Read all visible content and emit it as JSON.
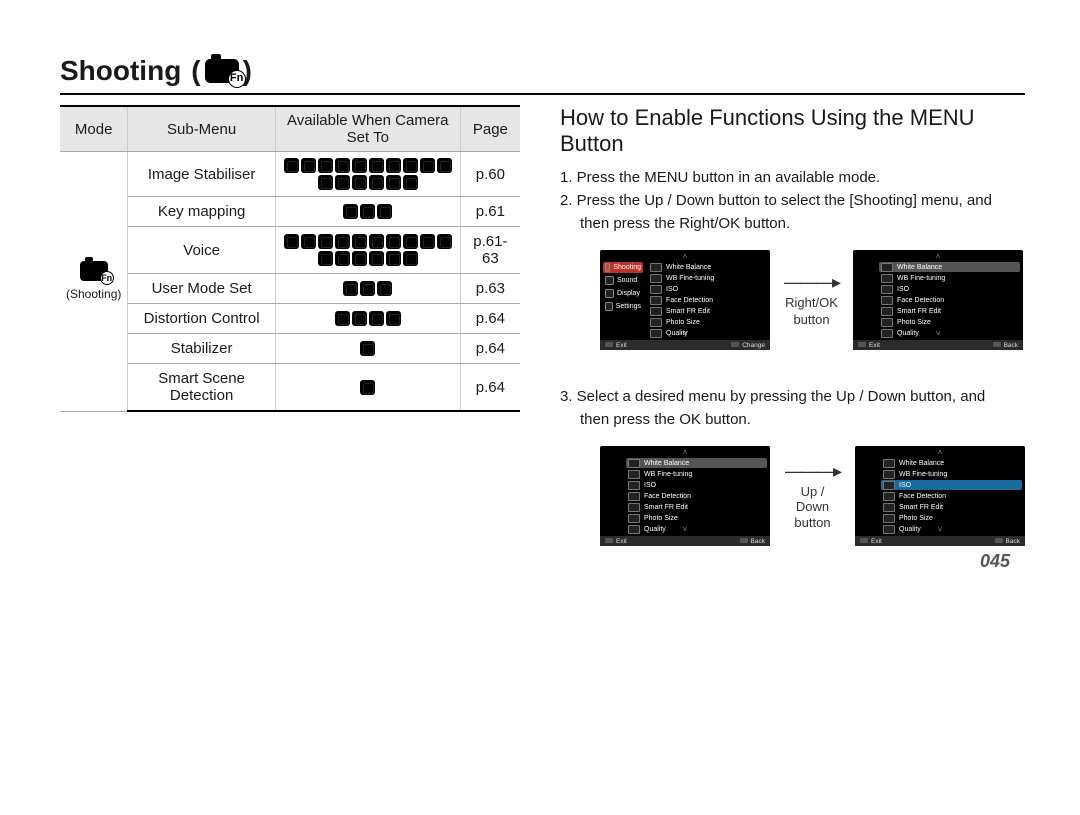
{
  "title": "Shooting",
  "page_number": "045",
  "table": {
    "headers": [
      "Mode",
      "Sub-Menu",
      "Available When Camera Set To",
      "Page"
    ],
    "mode_caption": "(Shooting)",
    "rows": [
      {
        "submenu": "Image Stabiliser",
        "icons": 16,
        "page": "p.60"
      },
      {
        "submenu": "Key mapping",
        "icons": 3,
        "page": "p.61"
      },
      {
        "submenu": "Voice",
        "icons": 16,
        "page": "p.61-63"
      },
      {
        "submenu": "User Mode Set",
        "icons": 3,
        "page": "p.63"
      },
      {
        "submenu": "Distortion Control",
        "icons": 4,
        "page": "p.64"
      },
      {
        "submenu": "Stabilizer",
        "icons": 1,
        "page": "p.64"
      },
      {
        "submenu": "Smart Scene Detection",
        "icons": 1,
        "page": "p.64"
      }
    ]
  },
  "right": {
    "heading": "How to Enable Functions Using the MENU Button",
    "step1": "1. Press the MENU button in an available mode.",
    "step2_l1": "2. Press the Up / Down button to select the [Shooting] menu, and",
    "step2_l2": "then press the Right/OK button.",
    "step3_l1": "3. Select a desired menu by pressing the Up / Down button, and",
    "step3_l2": "then press the OK button.",
    "arrow1_l1": "Right/OK",
    "arrow1_l2": "button",
    "arrow2_l1": "Up / Down",
    "arrow2_l2": "button"
  },
  "screen": {
    "tabs": [
      "Shooting",
      "Sound",
      "Display",
      "Settings"
    ],
    "items": [
      "White Balance",
      "WB Fine-tuning",
      "ISO",
      "Face Detection",
      "Smart FR Edit",
      "Photo Size",
      "Quality"
    ],
    "footer_left": "Exit",
    "footer_mid_change": "Change",
    "footer_mid_back": "Back"
  }
}
